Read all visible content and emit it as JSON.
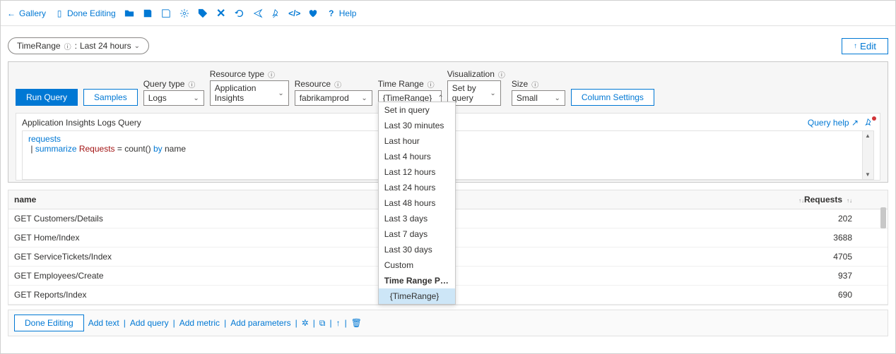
{
  "toolbar": {
    "gallery": "Gallery",
    "done_editing": "Done Editing",
    "help": "Help"
  },
  "param_pill": {
    "name": "TimeRange",
    "sep": ":",
    "value": "Last 24 hours"
  },
  "edit_pane": {
    "edit": "Edit"
  },
  "query_controls": {
    "run": "Run Query",
    "samples": "Samples",
    "query_type_label": "Query type",
    "query_type": "Logs",
    "resource_type_label": "Resource type",
    "resource_type": "Application Insights",
    "resource_label": "Resource",
    "resource": "fabrikamprod",
    "time_range_label": "Time Range",
    "time_range": "{TimeRange}",
    "visualization_label": "Visualization",
    "visualization": "Set by query",
    "size_label": "Size",
    "size": "Small",
    "column_settings": "Column Settings"
  },
  "time_range_options": [
    "Set in query",
    "Last 30 minutes",
    "Last hour",
    "Last 4 hours",
    "Last 12 hours",
    "Last 24 hours",
    "Last 48 hours",
    "Last 3 days",
    "Last 7 days",
    "Last 30 days",
    "Custom"
  ],
  "time_range_section": "Time Range Para…",
  "time_range_selected": "{TimeRange}",
  "query_body": {
    "title": "Application Insights Logs Query",
    "help": "Query help",
    "code_line1": "requests",
    "code_line2_pipe": "|",
    "code_line2_kw1": "summarize",
    "code_line2_var": "Requests",
    "code_line2_eq": "= count()",
    "code_line2_kw2": "by",
    "code_line2_name": "name"
  },
  "columns": {
    "name": "name",
    "requests": "Requests"
  },
  "rows": [
    {
      "name": "GET Customers/Details",
      "requests": "202"
    },
    {
      "name": "GET Home/Index",
      "requests": "3688"
    },
    {
      "name": "GET ServiceTickets/Index",
      "requests": "4705"
    },
    {
      "name": "GET Employees/Create",
      "requests": "937"
    },
    {
      "name": "GET Reports/Index",
      "requests": "690"
    }
  ],
  "footer": {
    "done": "Done Editing",
    "add_text": "Add text",
    "add_query": "Add query",
    "add_metric": "Add metric",
    "add_params": "Add parameters"
  }
}
